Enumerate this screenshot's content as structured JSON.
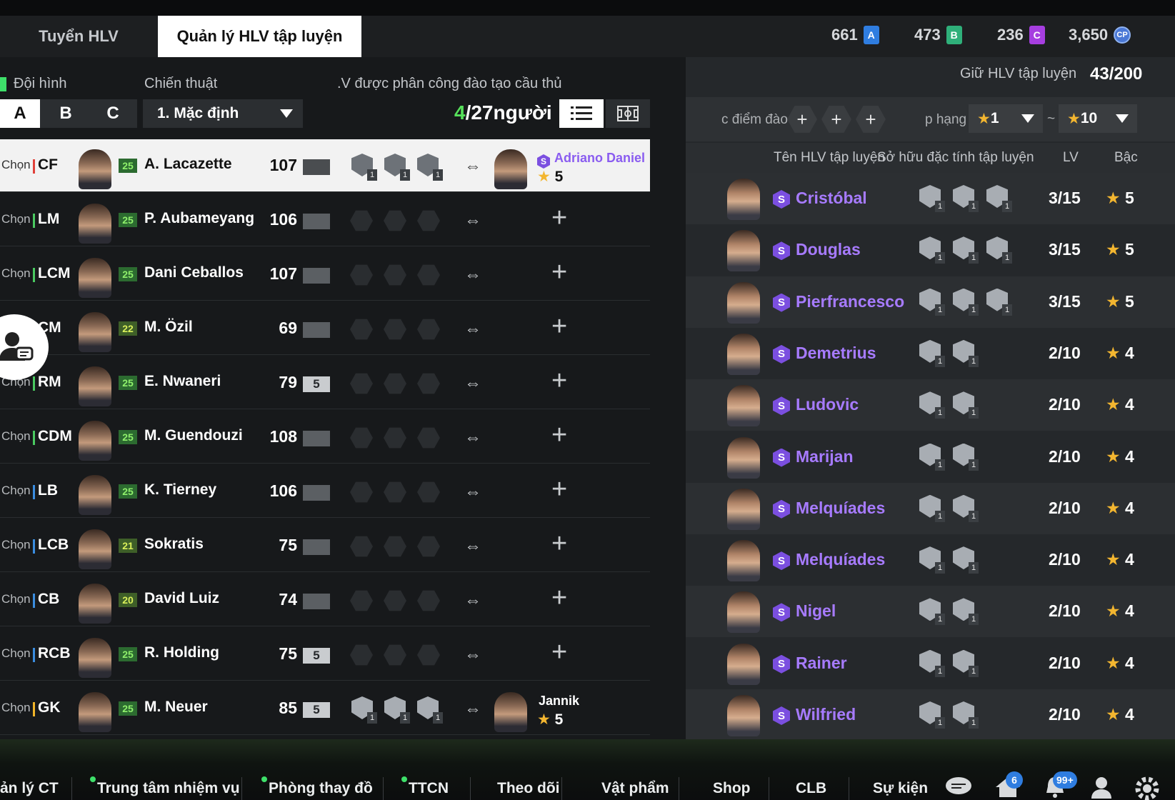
{
  "tabs": [
    {
      "label": "Tuyển HLV",
      "active": false
    },
    {
      "label": "Quản lý HLV tập luyện",
      "active": true
    }
  ],
  "currencies": [
    {
      "value": "661",
      "icon": "A",
      "color": "#2f7de0"
    },
    {
      "value": "473",
      "icon": "B",
      "color": "#2fb07a"
    },
    {
      "value": "236",
      "icon": "C",
      "color": "#a63ee0"
    },
    {
      "value": "3,650",
      "icon": "CP",
      "color": "#4a78d6"
    }
  ],
  "left": {
    "formation_label": "Đội hình",
    "tactic_label": "Chiến thuật",
    "assigned_label": ".V được phân công đào tạo cầu thủ",
    "squads": [
      "A",
      "B",
      "C"
    ],
    "tactic_value": "1. Mặc định",
    "count_current": "4",
    "count_rest": "/27người"
  },
  "players": [
    {
      "select": "Chọn",
      "pos": "CF",
      "pos_color": "#e0413a",
      "ovr": "25",
      "name": "A. Lacazette",
      "rating": "107",
      "lv": "",
      "selected": true,
      "traits": [
        "1",
        "1",
        "1"
      ],
      "coach": {
        "name": "Adriano Daniel",
        "star": "5",
        "special": true
      }
    },
    {
      "select": "Chọn",
      "pos": "LM",
      "pos_color": "#4ac960",
      "ovr": "25",
      "name": "P. Aubameyang",
      "rating": "106",
      "lv": "",
      "selected": false,
      "traits": [],
      "coach": null
    },
    {
      "select": "Chọn",
      "pos": "LCM",
      "pos_color": "#4ac960",
      "ovr": "25",
      "name": "Dani Ceballos",
      "rating": "107",
      "lv": "",
      "selected": false,
      "traits": [],
      "coach": null
    },
    {
      "select": "Chọn",
      "pos": "CM",
      "pos_color": "#4ac960",
      "ovr": "22",
      "name": "M. Özil",
      "rating": "69",
      "lv": "",
      "selected": false,
      "traits": [],
      "coach": null
    },
    {
      "select": "Chọn",
      "pos": "RM",
      "pos_color": "#4ac960",
      "ovr": "25",
      "name": "E. Nwaneri",
      "rating": "79",
      "lv": "5",
      "selected": false,
      "traits": [],
      "coach": null
    },
    {
      "select": "Chọn",
      "pos": "CDM",
      "pos_color": "#4ac960",
      "ovr": "25",
      "name": "M. Guendouzi",
      "rating": "108",
      "lv": "",
      "selected": false,
      "traits": [],
      "coach": null
    },
    {
      "select": "Chọn",
      "pos": "LB",
      "pos_color": "#3a8de0",
      "ovr": "25",
      "name": "K. Tierney",
      "rating": "106",
      "lv": "",
      "selected": false,
      "traits": [],
      "coach": null
    },
    {
      "select": "Chọn",
      "pos": "LCB",
      "pos_color": "#3a8de0",
      "ovr": "21",
      "name": "Sokratis",
      "rating": "75",
      "lv": "",
      "selected": false,
      "traits": [],
      "coach": null
    },
    {
      "select": "Chọn",
      "pos": "CB",
      "pos_color": "#3a8de0",
      "ovr": "20",
      "name": "David Luiz",
      "rating": "74",
      "lv": "",
      "selected": false,
      "traits": [],
      "coach": null
    },
    {
      "select": "Chọn",
      "pos": "RCB",
      "pos_color": "#3a8de0",
      "ovr": "25",
      "name": "R. Holding",
      "rating": "75",
      "lv": "5",
      "selected": false,
      "traits": [],
      "coach": null
    },
    {
      "select": "Chọn",
      "pos": "GK",
      "pos_color": "#f0b429",
      "ovr": "25",
      "name": "M. Neuer",
      "rating": "85",
      "lv": "5",
      "selected": false,
      "traits": [
        "1",
        "1",
        "1"
      ],
      "coach": {
        "name": "Jannik",
        "star": "5",
        "special": false
      }
    }
  ],
  "right": {
    "keep_label": "Giữ HLV tập luyện",
    "keep_value": "43/200",
    "filter_points_label": "c điểm đào",
    "filter_rank_label": "p hạng",
    "rank_from": "1",
    "rank_sep": "~",
    "rank_to": "10",
    "col_name": "Tên HLV tập luyện",
    "col_traits": "Sở hữu đặc tính tập luyện",
    "col_lv": "LV",
    "col_grade": "Bậc"
  },
  "coaches": [
    {
      "badge": "S",
      "name": "Cristóbal",
      "lv": "3/15",
      "grade": "5",
      "traits": [
        "1",
        "1",
        "1"
      ]
    },
    {
      "badge": "S",
      "name": "Douglas",
      "lv": "3/15",
      "grade": "5",
      "traits": [
        "1",
        "1",
        "1"
      ]
    },
    {
      "badge": "S",
      "name": "Pierfrancesco",
      "lv": "3/15",
      "grade": "5",
      "traits": [
        "1",
        "1",
        "1"
      ]
    },
    {
      "badge": "S",
      "name": "Demetrius",
      "lv": "2/10",
      "grade": "4",
      "traits": [
        "1",
        "1"
      ]
    },
    {
      "badge": "S",
      "name": "Ludovic",
      "lv": "2/10",
      "grade": "4",
      "traits": [
        "1",
        "1"
      ]
    },
    {
      "badge": "S",
      "name": "Marijan",
      "lv": "2/10",
      "grade": "4",
      "traits": [
        "1",
        "1"
      ]
    },
    {
      "badge": "S",
      "name": "Melquíades",
      "lv": "2/10",
      "grade": "4",
      "traits": [
        "1",
        "1"
      ]
    },
    {
      "badge": "S",
      "name": "Melquíades",
      "lv": "2/10",
      "grade": "4",
      "traits": [
        "1",
        "1"
      ]
    },
    {
      "badge": "S",
      "name": "Nigel",
      "lv": "2/10",
      "grade": "4",
      "traits": [
        "1",
        "1"
      ]
    },
    {
      "badge": "S",
      "name": "Rainer",
      "lv": "2/10",
      "grade": "4",
      "traits": [
        "1",
        "1"
      ]
    },
    {
      "badge": "S",
      "name": "Wilfried",
      "lv": "2/10",
      "grade": "4",
      "traits": [
        "1",
        "1"
      ]
    }
  ],
  "nav": {
    "items": [
      {
        "label": "ản lý CT",
        "dot": false
      },
      {
        "label": "Trung tâm nhiệm vụ",
        "dot": true
      },
      {
        "label": "Phòng thay đồ",
        "dot": true
      },
      {
        "label": "TTCN",
        "dot": true
      },
      {
        "label": "Theo dõi",
        "dot": false
      },
      {
        "label": "Vật phẩm",
        "dot": false
      },
      {
        "label": "Shop",
        "dot": false
      },
      {
        "label": "CLB",
        "dot": false
      },
      {
        "label": "Sự kiện",
        "dot": false
      }
    ],
    "home_badge": "6",
    "bell_badge": "99+"
  }
}
